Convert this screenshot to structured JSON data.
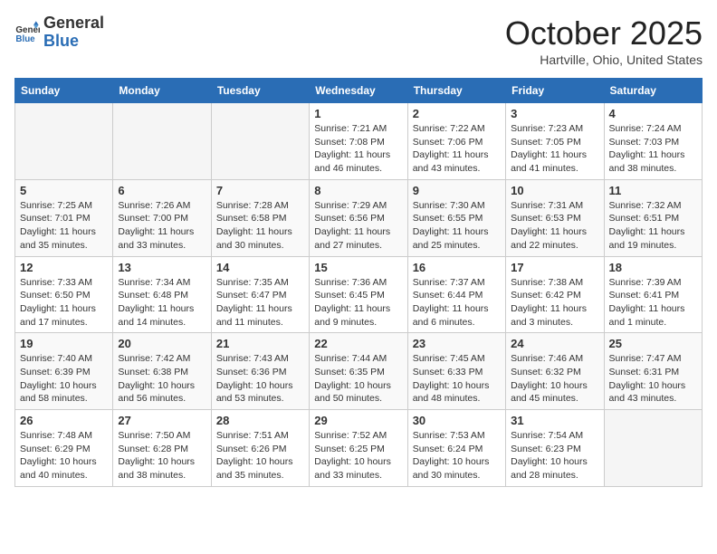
{
  "header": {
    "logo_general": "General",
    "logo_blue": "Blue",
    "month_title": "October 2025",
    "location": "Hartville, Ohio, United States"
  },
  "weekdays": [
    "Sunday",
    "Monday",
    "Tuesday",
    "Wednesday",
    "Thursday",
    "Friday",
    "Saturday"
  ],
  "weeks": [
    [
      {
        "day": "",
        "info": ""
      },
      {
        "day": "",
        "info": ""
      },
      {
        "day": "",
        "info": ""
      },
      {
        "day": "1",
        "info": "Sunrise: 7:21 AM\nSunset: 7:08 PM\nDaylight: 11 hours and 46 minutes."
      },
      {
        "day": "2",
        "info": "Sunrise: 7:22 AM\nSunset: 7:06 PM\nDaylight: 11 hours and 43 minutes."
      },
      {
        "day": "3",
        "info": "Sunrise: 7:23 AM\nSunset: 7:05 PM\nDaylight: 11 hours and 41 minutes."
      },
      {
        "day": "4",
        "info": "Sunrise: 7:24 AM\nSunset: 7:03 PM\nDaylight: 11 hours and 38 minutes."
      }
    ],
    [
      {
        "day": "5",
        "info": "Sunrise: 7:25 AM\nSunset: 7:01 PM\nDaylight: 11 hours and 35 minutes."
      },
      {
        "day": "6",
        "info": "Sunrise: 7:26 AM\nSunset: 7:00 PM\nDaylight: 11 hours and 33 minutes."
      },
      {
        "day": "7",
        "info": "Sunrise: 7:28 AM\nSunset: 6:58 PM\nDaylight: 11 hours and 30 minutes."
      },
      {
        "day": "8",
        "info": "Sunrise: 7:29 AM\nSunset: 6:56 PM\nDaylight: 11 hours and 27 minutes."
      },
      {
        "day": "9",
        "info": "Sunrise: 7:30 AM\nSunset: 6:55 PM\nDaylight: 11 hours and 25 minutes."
      },
      {
        "day": "10",
        "info": "Sunrise: 7:31 AM\nSunset: 6:53 PM\nDaylight: 11 hours and 22 minutes."
      },
      {
        "day": "11",
        "info": "Sunrise: 7:32 AM\nSunset: 6:51 PM\nDaylight: 11 hours and 19 minutes."
      }
    ],
    [
      {
        "day": "12",
        "info": "Sunrise: 7:33 AM\nSunset: 6:50 PM\nDaylight: 11 hours and 17 minutes."
      },
      {
        "day": "13",
        "info": "Sunrise: 7:34 AM\nSunset: 6:48 PM\nDaylight: 11 hours and 14 minutes."
      },
      {
        "day": "14",
        "info": "Sunrise: 7:35 AM\nSunset: 6:47 PM\nDaylight: 11 hours and 11 minutes."
      },
      {
        "day": "15",
        "info": "Sunrise: 7:36 AM\nSunset: 6:45 PM\nDaylight: 11 hours and 9 minutes."
      },
      {
        "day": "16",
        "info": "Sunrise: 7:37 AM\nSunset: 6:44 PM\nDaylight: 11 hours and 6 minutes."
      },
      {
        "day": "17",
        "info": "Sunrise: 7:38 AM\nSunset: 6:42 PM\nDaylight: 11 hours and 3 minutes."
      },
      {
        "day": "18",
        "info": "Sunrise: 7:39 AM\nSunset: 6:41 PM\nDaylight: 11 hours and 1 minute."
      }
    ],
    [
      {
        "day": "19",
        "info": "Sunrise: 7:40 AM\nSunset: 6:39 PM\nDaylight: 10 hours and 58 minutes."
      },
      {
        "day": "20",
        "info": "Sunrise: 7:42 AM\nSunset: 6:38 PM\nDaylight: 10 hours and 56 minutes."
      },
      {
        "day": "21",
        "info": "Sunrise: 7:43 AM\nSunset: 6:36 PM\nDaylight: 10 hours and 53 minutes."
      },
      {
        "day": "22",
        "info": "Sunrise: 7:44 AM\nSunset: 6:35 PM\nDaylight: 10 hours and 50 minutes."
      },
      {
        "day": "23",
        "info": "Sunrise: 7:45 AM\nSunset: 6:33 PM\nDaylight: 10 hours and 48 minutes."
      },
      {
        "day": "24",
        "info": "Sunrise: 7:46 AM\nSunset: 6:32 PM\nDaylight: 10 hours and 45 minutes."
      },
      {
        "day": "25",
        "info": "Sunrise: 7:47 AM\nSunset: 6:31 PM\nDaylight: 10 hours and 43 minutes."
      }
    ],
    [
      {
        "day": "26",
        "info": "Sunrise: 7:48 AM\nSunset: 6:29 PM\nDaylight: 10 hours and 40 minutes."
      },
      {
        "day": "27",
        "info": "Sunrise: 7:50 AM\nSunset: 6:28 PM\nDaylight: 10 hours and 38 minutes."
      },
      {
        "day": "28",
        "info": "Sunrise: 7:51 AM\nSunset: 6:26 PM\nDaylight: 10 hours and 35 minutes."
      },
      {
        "day": "29",
        "info": "Sunrise: 7:52 AM\nSunset: 6:25 PM\nDaylight: 10 hours and 33 minutes."
      },
      {
        "day": "30",
        "info": "Sunrise: 7:53 AM\nSunset: 6:24 PM\nDaylight: 10 hours and 30 minutes."
      },
      {
        "day": "31",
        "info": "Sunrise: 7:54 AM\nSunset: 6:23 PM\nDaylight: 10 hours and 28 minutes."
      },
      {
        "day": "",
        "info": ""
      }
    ]
  ]
}
